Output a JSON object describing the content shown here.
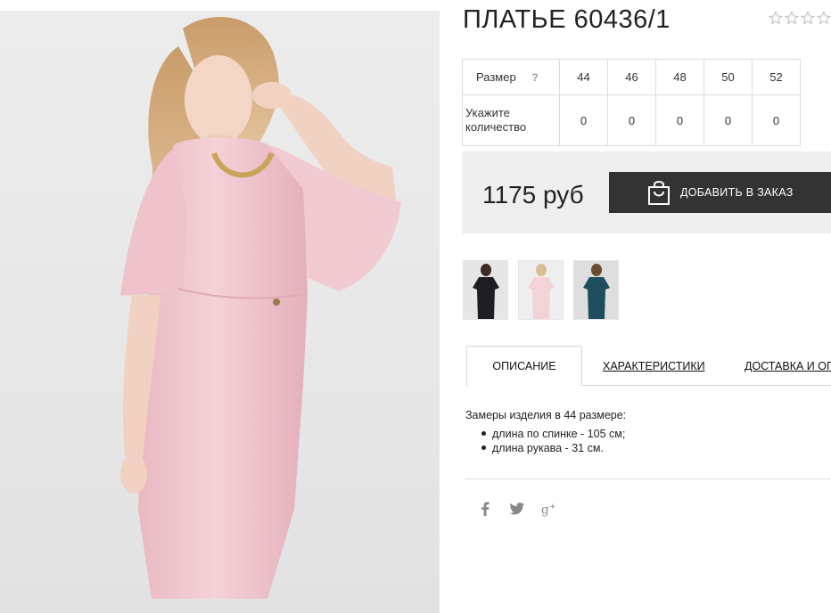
{
  "product": {
    "title": "ПЛАТЬЕ 60436/1",
    "rating_stars": 5,
    "rating_filled": 0
  },
  "size_table": {
    "size_label": "Размер",
    "help": "?",
    "sizes": [
      "44",
      "46",
      "48",
      "50",
      "52"
    ],
    "qty_label_line1": "Укажите",
    "qty_label_line2": "количество",
    "quantities": [
      "0",
      "0",
      "0",
      "0",
      "0"
    ]
  },
  "order": {
    "price": "1175 руб",
    "add_button_label": "ДОБАВИТЬ В ЗАКАЗ"
  },
  "thumbnails": [
    {
      "color": "black dress"
    },
    {
      "color": "pink dress"
    },
    {
      "color": "teal dress"
    }
  ],
  "tabs": [
    {
      "label": "ОПИСАНИЕ",
      "active": true
    },
    {
      "label": "ХАРАКТЕРИСТИКИ",
      "active": false
    },
    {
      "label": "ДОСТАВКА И ОПЛАТА",
      "active": false
    }
  ],
  "description": {
    "intro": "Замеры изделия в 44 размере:",
    "items": [
      "длина по спинке - 105 см;",
      "длина рукава - 31 см."
    ]
  },
  "social": [
    "facebook-icon",
    "twitter-icon",
    "google-plus-icon"
  ],
  "colors": {
    "button_bg": "#333333",
    "price_bar_bg": "#efefef",
    "dress_pink": "#f0c8cf"
  }
}
